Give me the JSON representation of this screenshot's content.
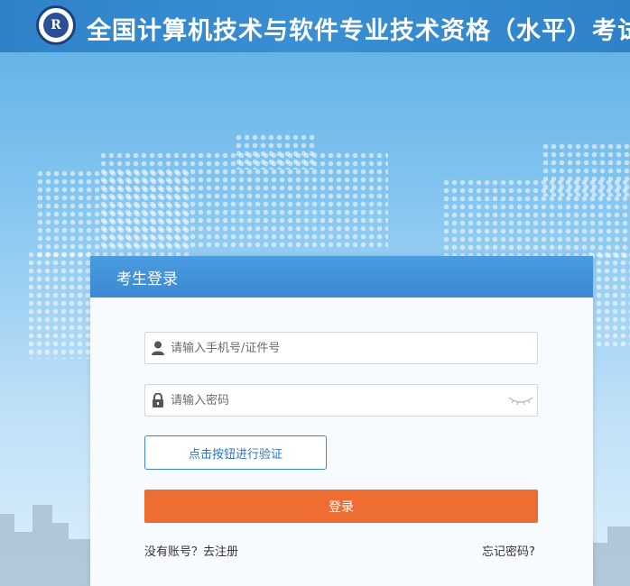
{
  "header": {
    "title": "全国计算机技术与软件专业技术资格（水平）考试",
    "logo_text": "R"
  },
  "login": {
    "title": "考生登录",
    "username_placeholder": "请输入手机号/证件号",
    "password_placeholder": "请输入密码",
    "verify_label": "点击按钮进行验证",
    "submit_label": "登录",
    "register_link": "没有账号？去注册",
    "forgot_link": "忘记密码?"
  },
  "colors": {
    "header": "#2f82c8",
    "card_header": "#3b89d2",
    "login_button": "#ee6d32",
    "verify_border": "#3f84cf"
  },
  "icons": {
    "username": "user-icon",
    "password": "lock-icon",
    "toggle": "eye-closed-icon"
  }
}
